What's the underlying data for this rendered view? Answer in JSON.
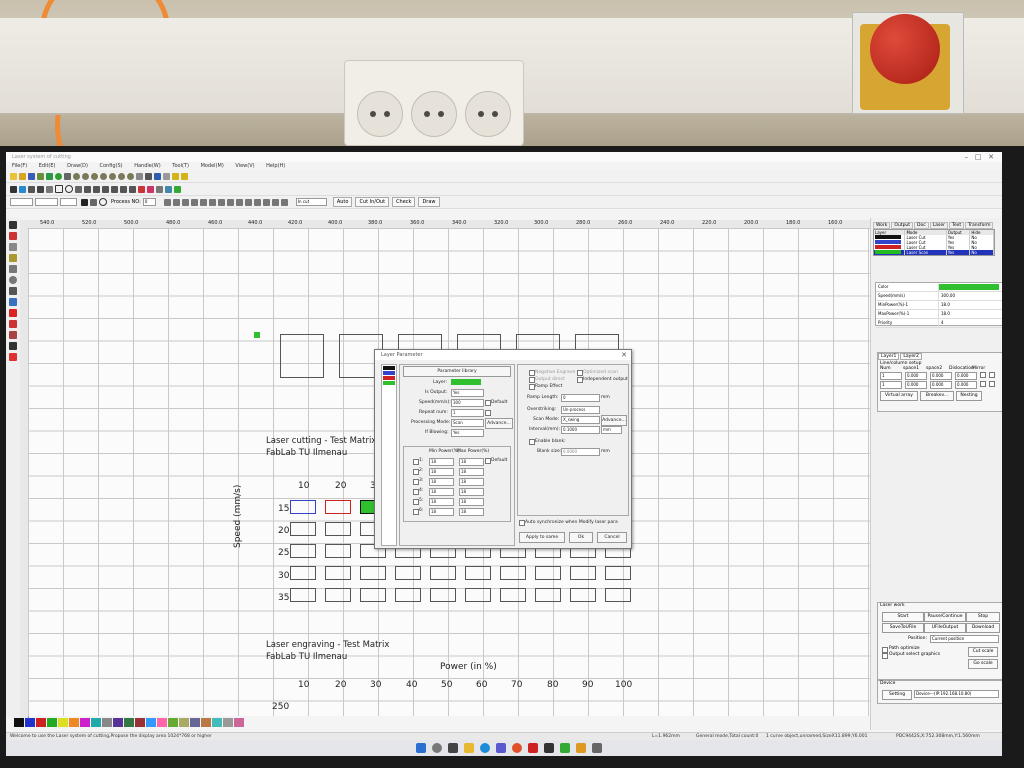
{
  "window": {
    "title": "Laser system of cutting",
    "controls": [
      "–",
      "□",
      "✕"
    ]
  },
  "menu": [
    "File(F)",
    "Edit(E)",
    "Draw(D)",
    "Config(S)",
    "Handle(W)",
    "Tool(T)",
    "Model(M)",
    "View(V)",
    "Help(H)"
  ],
  "toolbar": {
    "layer_select": "In cut",
    "buttons": [
      "Auto",
      "Cut In/Out",
      "Check",
      "Draw"
    ],
    "process_no_label": "Process NO:",
    "process_no_value": "0"
  },
  "ruler_marks": [
    "540.0",
    "520.0",
    "500.0",
    "480.0",
    "460.0",
    "440.0",
    "420.0",
    "400.0",
    "380.0",
    "360.0",
    "340.0",
    "320.0",
    "300.0",
    "280.0",
    "260.0",
    "240.0",
    "220.0",
    "200.0",
    "180.0",
    "160.0"
  ],
  "canvas": {
    "cutting_title": "Laser cutting - Test Matrix",
    "cutting_subtitle": "FabLab TU Ilmenau",
    "cutting_power_cols": [
      "10",
      "20",
      "30"
    ],
    "cutting_speed_rows": [
      "15",
      "20",
      "25",
      "30",
      "35"
    ],
    "speed_axis_label": "Speed (mm/s)",
    "engraving_title": "Laser engraving - Test Matrix",
    "engraving_subtitle": "FabLab TU Ilmenau",
    "power_axis_label": "Power (in %)",
    "engraving_power_cols": [
      "10",
      "20",
      "30",
      "40",
      "50",
      "60",
      "70",
      "80",
      "90",
      "100"
    ],
    "engraving_first_row": "250"
  },
  "right_panel": {
    "tabs": [
      "Work",
      "Output",
      "Doc",
      "Laser",
      "Text",
      "Transform"
    ],
    "layer_headers": [
      "Layer",
      "Mode",
      "Output",
      "Hide"
    ],
    "layers": [
      {
        "color": "#111111",
        "mode": "Laser Cut",
        "output": "Yes",
        "hide": "No"
      },
      {
        "color": "#3344cc",
        "mode": "Laser Cut",
        "output": "Yes",
        "hide": "No"
      },
      {
        "color": "#cc2222",
        "mode": "Laser Cut",
        "output": "Yes",
        "hide": "No"
      },
      {
        "color": "#22bb22",
        "mode": "Laser Scan",
        "output": "Yes",
        "hide": "No"
      }
    ],
    "props": [
      {
        "k": "Color",
        "v": ""
      },
      {
        "k": "Speed(mm/s)",
        "v": "300.00"
      },
      {
        "k": "MinPower(%)-1",
        "v": "18.0"
      },
      {
        "k": "MaxPower(%)-1",
        "v": "18.0"
      },
      {
        "k": "Priority",
        "v": "4"
      }
    ],
    "layer_tabs": [
      "Layer1",
      "Layer2"
    ],
    "array_title": "Line/column setup",
    "array_headers": [
      "Num",
      "space1",
      "space2",
      "Dislocation",
      "Mirror"
    ],
    "array_x": [
      "1",
      "0.000",
      "0.000",
      "0.000"
    ],
    "array_y": [
      "1",
      "0.000",
      "0.000",
      "0.000"
    ],
    "array_buttons": [
      "Virtual array",
      "Breakev...",
      "Nesting"
    ],
    "laser_work_title": "Laser work",
    "work_buttons": [
      "Start",
      "Pause/Continue",
      "Stop",
      "SaveToUFile",
      "UFileOutput",
      "Download"
    ],
    "position_label": "Position:",
    "position_value": "Current position",
    "path_optimize": "Path optimize",
    "output_select": "Output select graphics",
    "cut_scale": "Cut scale",
    "go_scale": "Go scale",
    "device_title": "Device",
    "setting_btn": "Setting",
    "device_value": "Device---(IP:192.168.10.80)"
  },
  "dialog": {
    "title": "Layer Parameter",
    "library_btn": "Parameter library",
    "layer_label": "Layer:",
    "layer_color": "#2fbf2f",
    "is_output_label": "Is Output:",
    "is_output_value": "Yes",
    "speed_label": "Speed(mm/s):",
    "speed_value": "300",
    "default_label": "Default",
    "repeat_label": "Repeat num:",
    "repeat_value": "1",
    "processing_label": "Processing Mode:",
    "processing_value": "Scan",
    "advance_btn": "Advance...",
    "if_blowing_label": "If Blowing:",
    "if_blowing_value": "Yes",
    "power_headers": [
      "Min Power(%)",
      "Max Power(%)"
    ],
    "power_rows": [
      {
        "label": "1:",
        "min": "18",
        "max": "18"
      },
      {
        "label": "2:",
        "min": "18",
        "max": "18"
      },
      {
        "label": "3:",
        "min": "18",
        "max": "18"
      },
      {
        "label": "4:",
        "min": "18",
        "max": "18"
      },
      {
        "label": "5:",
        "min": "18",
        "max": "18"
      },
      {
        "label": "6:",
        "min": "18",
        "max": "18"
      }
    ],
    "negative_engrave": "Negative Engrave",
    "output_direct": "Output direct",
    "optimized_scan": "Optimized scan",
    "independent_output": "Independent output",
    "ramp_effect": "Ramp Effect",
    "ramp_length_label": "Ramp Length:",
    "ramp_length_value": "0",
    "ramp_unit": "mm",
    "overstriking_label": "Overstriking:",
    "overstriking_value": "Un-process",
    "scan_mode_label": "Scan Mode:",
    "scan_mode_value": "X_swing",
    "advance2_btn": "Advance...",
    "interval_label": "Interval(mm):",
    "interval_value": "0.1000",
    "interval_unit": "mm",
    "enable_blank": "Enable blank:",
    "blank_size_label": "Blank size:",
    "blank_size_value": "0.0000",
    "blank_unit": "mm",
    "auto_sync": "Auto synchronize when Modify laser para",
    "apply_btn": "Apply to same",
    "ok_btn": "Ok",
    "cancel_btn": "Cancel"
  },
  "status": {
    "welcome": "Welcome to use the Laser system of cutting,Propose the display area 1024*768 or higher",
    "length": "L=1.962mm",
    "mode": "General mode,Total count:0",
    "selection": "1 curve object,unnamed,SizeX11.899,Y6.001",
    "coords": "PDC9442S,X:752.308mm,Y:1.560mm"
  },
  "palette": [
    "#111111",
    "#2233cc",
    "#cc2222",
    "#22aa22",
    "#dddd22",
    "#ee8822",
    "#cc22cc",
    "#22aaaa",
    "#888888",
    "#553399",
    "#337744",
    "#993333",
    "#3399ff",
    "#ff66aa",
    "#66aa33",
    "#aaaa66",
    "#666699",
    "#bb7744",
    "#44bbbb",
    "#999999",
    "#cc6699"
  ]
}
